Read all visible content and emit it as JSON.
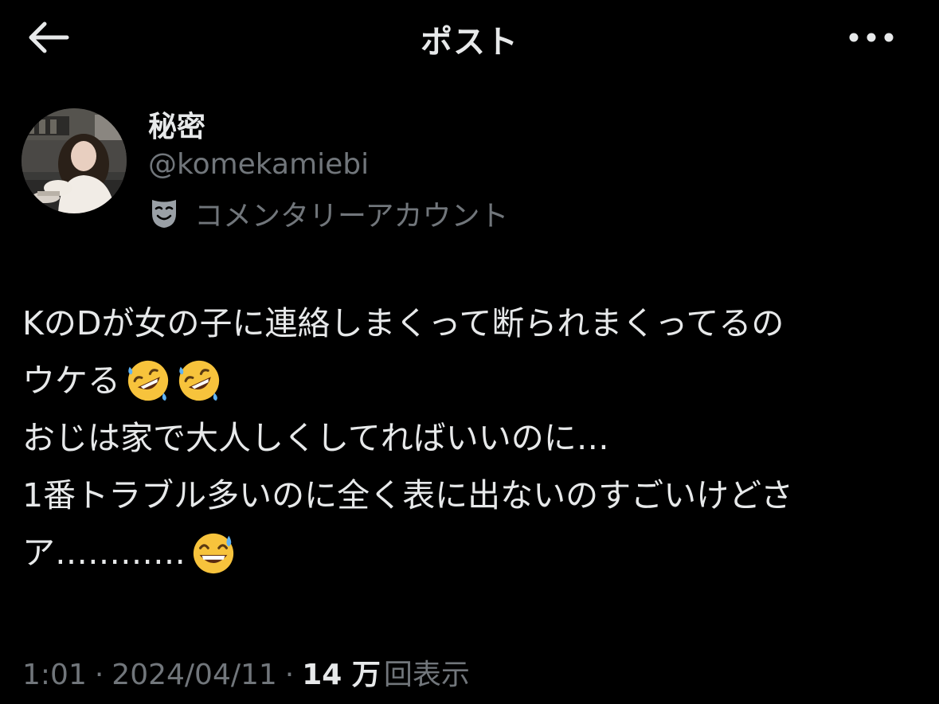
{
  "header": {
    "title": "ポスト",
    "back_icon": "arrow-left-icon",
    "more_icon": "more-horizontal-icon"
  },
  "author": {
    "display_name": "秘密",
    "handle": "@komekamiebi",
    "label": "コメンタリーアカウント",
    "label_icon": "theater-mask-icon"
  },
  "tweet": {
    "line1": "KのDが女の子に連絡しまくって断られまくってるの",
    "line2": "ウケる",
    "line2_emojis": [
      "rolling-on-floor-laughing-emoji",
      "rolling-on-floor-laughing-emoji"
    ],
    "line3": "おじは家で大人しくしてればいいのに…",
    "line4": "1番トラブル多いのに全く表に出ないのすごいけどさ",
    "line5": "ア…………",
    "line5_emoji": "grinning-sweat-emoji"
  },
  "meta": {
    "time": "1:01",
    "separator": "·",
    "date": "2024/04/11",
    "views_count": "14 万",
    "views_label": "回表示"
  },
  "colors": {
    "background": "#000000",
    "primary_text": "#e7e9ea",
    "secondary_text": "#71767b"
  }
}
